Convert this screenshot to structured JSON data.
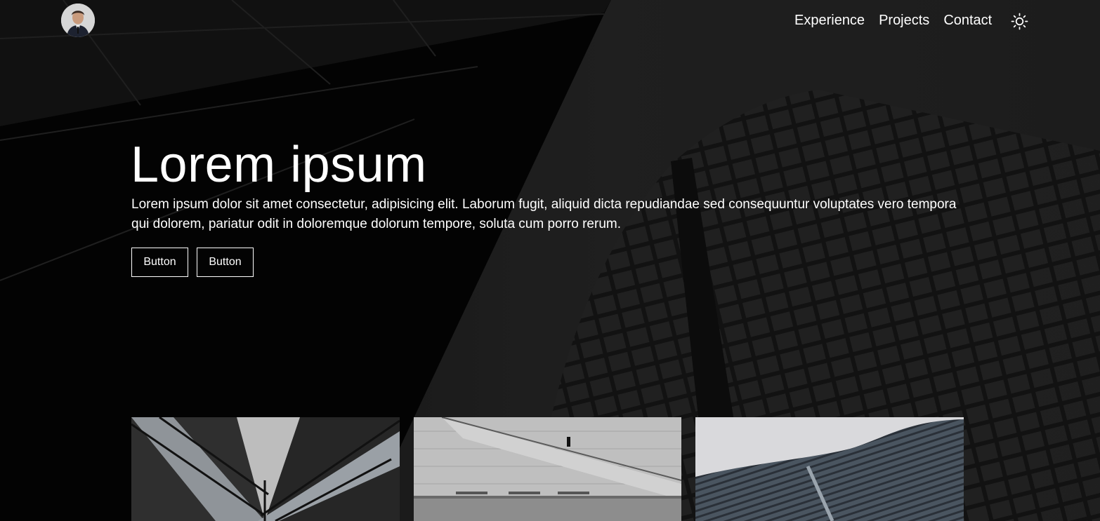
{
  "header": {
    "avatar_icon": "profile-avatar",
    "nav": [
      {
        "label": "Experience"
      },
      {
        "label": "Projects"
      },
      {
        "label": "Contact"
      }
    ],
    "theme_toggle_icon": "sun-icon"
  },
  "hero": {
    "title": "Lorem ipsum",
    "text": "Lorem ipsum dolor sit amet consectetur, adipisicing elit. Laborum fugit, aliquid dicta repudiandae sed consequuntur voluptates vero tempora qui dolorem, pariatur odit in doloremque dolorum tempore, soluta cum porro rerum.",
    "buttons": [
      {
        "label": "Button"
      },
      {
        "label": "Button"
      }
    ]
  },
  "cards": [
    {
      "image": "glass-facade-photo"
    },
    {
      "image": "staircase-wall-photo"
    },
    {
      "image": "curved-building-photo"
    }
  ],
  "colors": {
    "text": "#ffffff",
    "background": "#0d0d0d"
  }
}
